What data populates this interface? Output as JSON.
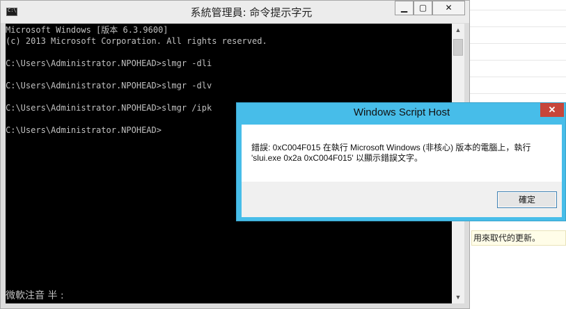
{
  "cmd": {
    "title": "系統管理員: 命令提示字元",
    "lines": [
      "Microsoft Windows [版本 6.3.9600]",
      "(c) 2013 Microsoft Corporation. All rights reserved.",
      "",
      "C:\\Users\\Administrator.NPOHEAD>slmgr -dli",
      "",
      "C:\\Users\\Administrator.NPOHEAD>slmgr -dlv",
      "",
      "C:\\Users\\Administrator.NPOHEAD>slmgr /ipk",
      "",
      "C:\\Users\\Administrator.NPOHEAD>"
    ],
    "ime_status": "微軟注音 半 :",
    "buttons": {
      "minimize": "▁",
      "maximize": "▢",
      "close": "✕"
    }
  },
  "dialog": {
    "title": "Windows Script Host",
    "message_line1": "錯誤: 0xC004F015 在執行 Microsoft Windows (非核心) 版本的電腦上，執行",
    "message_line2": "'slui.exe 0x2a 0xC004F015' 以顯示錯誤文字。",
    "ok_label": "確定",
    "close_label": "✕"
  },
  "background": {
    "hint_text": "用來取代的更新。"
  },
  "icons": [
    "cmd-app-icon",
    "close-icon",
    "scroll-up-icon",
    "scroll-down-icon"
  ]
}
